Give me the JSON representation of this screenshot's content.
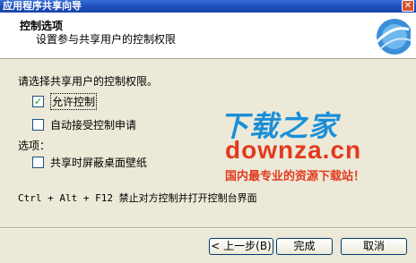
{
  "window": {
    "title": "应用程序共享向导",
    "close_glyph": "✕"
  },
  "header": {
    "title": "控制选项",
    "subtitle": "设置参与共享用户的控制权限"
  },
  "content": {
    "prompt": "请选择共享用户的控制权限。",
    "options": [
      {
        "label": "允许控制",
        "checked": true,
        "check_glyph": "✓"
      },
      {
        "label": "自动接受控制申请",
        "checked": false,
        "check_glyph": ""
      }
    ],
    "section_label": "选项：",
    "extra_options": [
      {
        "label": "共享时屏蔽桌面壁纸",
        "checked": false,
        "check_glyph": ""
      }
    ],
    "hotkey_text": "Ctrl + Alt + F12 禁止对方控制并打开控制台界面"
  },
  "watermark": {
    "brand": "下载之家",
    "url": "downza.cn",
    "slogan": "国内最专业的资源下载站！"
  },
  "buttons": {
    "back": "< 上一步(B)",
    "finish": "完成",
    "cancel": "取消"
  },
  "colors": {
    "titlebar": "#1f4fbf",
    "watermark_blue": "#1a8fd8",
    "watermark_red": "#e23a1e"
  }
}
